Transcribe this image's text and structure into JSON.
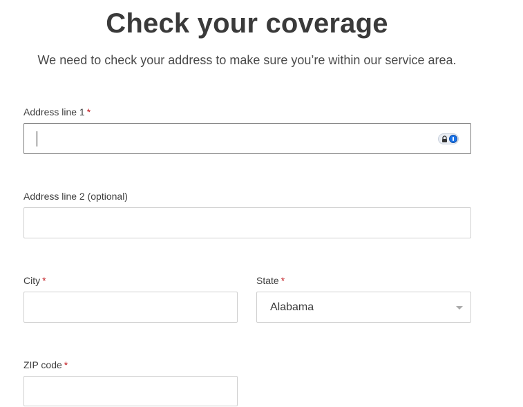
{
  "header": {
    "title": "Check your coverage",
    "subtitle": "We need to check your address to make sure you’re within our service area."
  },
  "form": {
    "address_line_1": {
      "label": "Address line 1",
      "required_mark": "*",
      "value": "",
      "placeholder": ""
    },
    "address_line_2": {
      "label": "Address line 2 (optional)",
      "value": "",
      "placeholder": ""
    },
    "city": {
      "label": "City",
      "required_mark": "*",
      "value": "",
      "placeholder": ""
    },
    "state": {
      "label": "State",
      "required_mark": "*",
      "selected": "Alabama"
    },
    "zip": {
      "label": "ZIP code",
      "required_mark": "*",
      "value": "",
      "placeholder": ""
    }
  },
  "icons": {
    "password_manager": "password-manager-icon",
    "dropdown": "chevron-down-icon"
  },
  "colors": {
    "required": "#c0161c",
    "text": "#3d3d3d",
    "border": "#cfcfcf",
    "focused_border": "#7a7a7a"
  }
}
